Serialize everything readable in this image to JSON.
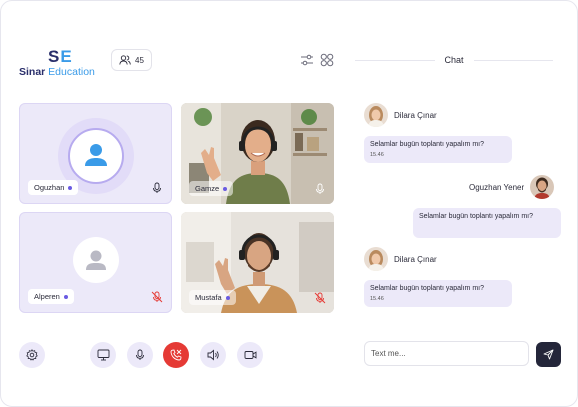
{
  "brand": {
    "mark_s": "S",
    "mark_e": "E",
    "name_a": "Sinar",
    "name_b": " Education"
  },
  "header": {
    "participant_count": "45",
    "chat_title": "Chat"
  },
  "tiles": [
    {
      "name": "Oguzhan",
      "kind": "avatar"
    },
    {
      "name": "Gamze",
      "kind": "video"
    },
    {
      "name": "Alperen",
      "kind": "avatar",
      "muted": true
    },
    {
      "name": "Mustafa",
      "kind": "video",
      "muted": true
    }
  ],
  "controls": [
    "gear-icon",
    "screen-share-icon",
    "microphone-icon",
    "end-call-icon",
    "speaker-icon",
    "camera-icon"
  ],
  "colors": {
    "accent": "#6a5be2",
    "tile_bg": "#ece9f9",
    "end_call": "#e53a35",
    "send": "#24263a"
  },
  "chat": {
    "messages": [
      {
        "sender": "Dilara Çınar",
        "text": "Selamlar bugün toplantı yapalım mı?",
        "time": "15.46"
      },
      {
        "sender": "Oguzhan Yener",
        "text": "Selamlar bugün toplantı yapalım mı?"
      },
      {
        "sender": "Dilara Çınar",
        "text": "Selamlar bugün toplantı yapalım mı?",
        "time": "15.46"
      }
    ],
    "input_placeholder": "Text me..."
  }
}
